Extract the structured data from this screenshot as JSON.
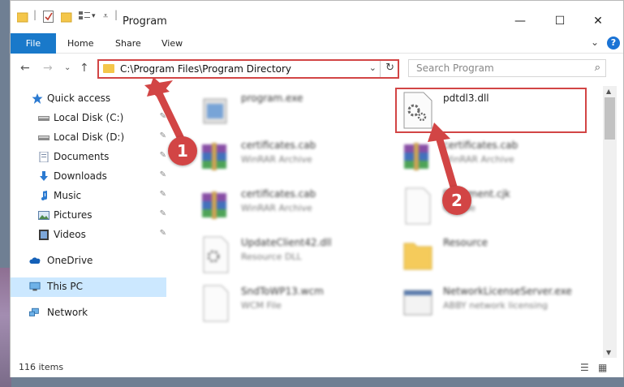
{
  "window": {
    "title": "Program",
    "controls": {
      "minimize": "—",
      "maximize": "☐",
      "close": "✕"
    }
  },
  "ribbon": {
    "tabs": [
      "File",
      "Home",
      "Share",
      "View"
    ],
    "collapse": "⌄",
    "help": "?"
  },
  "navigation": {
    "back": "←",
    "forward": "→",
    "recent": "⌄",
    "up": "↑",
    "address": "C:\\Program Files\\Program Directory",
    "address_dropdown": "⌄",
    "refresh": "↻",
    "search_placeholder": "Search Program",
    "search_icon": "⌕"
  },
  "sidebar": {
    "items": [
      {
        "label": "Quick access",
        "icon": "star-icon",
        "pinned": false
      },
      {
        "label": "Local Disk (C:)",
        "icon": "drive-icon",
        "pinned": true
      },
      {
        "label": "Local Disk (D:)",
        "icon": "drive-icon",
        "pinned": true
      },
      {
        "label": "Documents",
        "icon": "documents-icon",
        "pinned": true
      },
      {
        "label": "Downloads",
        "icon": "downloads-icon",
        "pinned": true
      },
      {
        "label": "Music",
        "icon": "music-icon",
        "pinned": true
      },
      {
        "label": "Pictures",
        "icon": "pictures-icon",
        "pinned": true
      },
      {
        "label": "Videos",
        "icon": "videos-icon",
        "pinned": true
      },
      {
        "label": "OneDrive",
        "icon": "onedrive-icon",
        "pinned": false
      },
      {
        "label": "This PC",
        "icon": "pc-icon",
        "pinned": false,
        "selected": true
      },
      {
        "label": "Network",
        "icon": "network-icon",
        "pinned": false
      }
    ],
    "pin_glyph": "📌"
  },
  "files": [
    {
      "name": "program.exe",
      "type": "",
      "icon": "exe-icon"
    },
    {
      "name": "pdtdl3.dll",
      "type": "",
      "icon": "dll-gear-icon",
      "highlighted": true
    },
    {
      "name": "certificates.cab",
      "type": "WinRAR Archive",
      "icon": "winrar-icon"
    },
    {
      "name": "certificates.cab",
      "type": "WinRAR Archive",
      "icon": "winrar-icon"
    },
    {
      "name": "certificates.cab",
      "type": "WinRAR Archive",
      "icon": "winrar-icon"
    },
    {
      "name": "Document.cjk",
      "type": "CJK File",
      "icon": "blank-file-icon"
    },
    {
      "name": "UpdateClient42.dll",
      "type": "Resource DLL",
      "icon": "dll-gear-icon"
    },
    {
      "name": "Resource",
      "type": "",
      "icon": "folder-icon"
    },
    {
      "name": "SndToWP13.wcm",
      "type": "WCM File",
      "icon": "blank-file-icon"
    },
    {
      "name": "NetworkLicenseServer.exe",
      "type": "ABBY network licensing",
      "icon": "app-window-icon"
    }
  ],
  "status": {
    "item_count": "116 items"
  },
  "annotations": {
    "step1": "1",
    "step2": "2",
    "color": "#d24545"
  },
  "colors": {
    "accent": "#1979ca",
    "selected_bg": "#cce8ff",
    "highlight_red": "#d24545",
    "folder_yellow": "#f4c64a"
  }
}
